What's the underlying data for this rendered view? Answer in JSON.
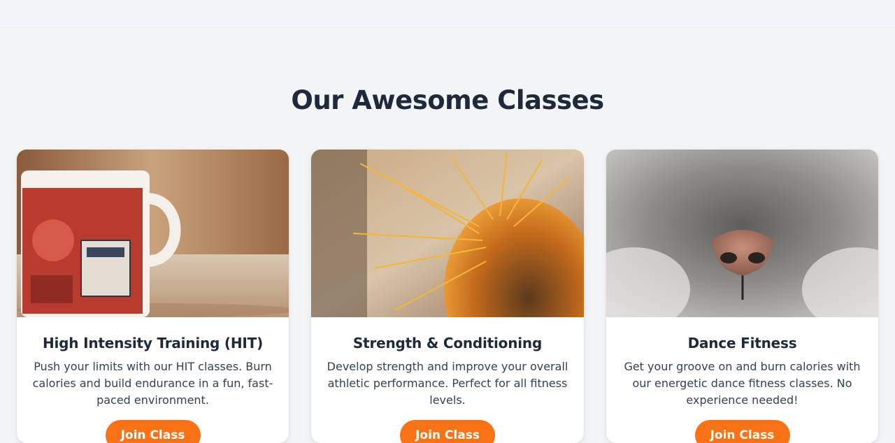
{
  "section": {
    "title": "Our Awesome Classes"
  },
  "classes": [
    {
      "title": "High Intensity Training (HIT)",
      "description": "Push your limits with our HIT classes. Burn calories and build endurance in a fun, fast-paced environment.",
      "button_label": "Join Class",
      "image_icon": "mug-photo"
    },
    {
      "title": "Strength & Conditioning",
      "description": "Develop strength and improve your overall athletic performance. Perfect for all fitness levels.",
      "button_label": "Join Class",
      "image_icon": "cactus-photo"
    },
    {
      "title": "Dance Fitness",
      "description": "Get your groove on and burn calories with our energetic dance fitness classes. No experience needed!",
      "button_label": "Join Class",
      "image_icon": "cat-nose-photo"
    }
  ],
  "colors": {
    "accent": "#f97316",
    "heading": "#1e293b",
    "background": "#f3f4f6"
  }
}
